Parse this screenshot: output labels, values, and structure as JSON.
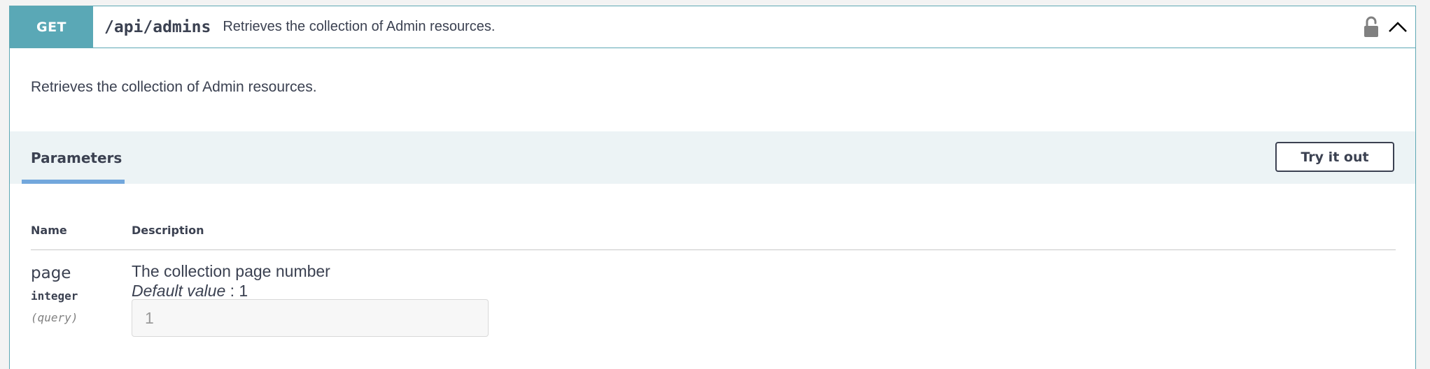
{
  "operation": {
    "method": "GET",
    "path": "/api/admins",
    "summary": "Retrieves the collection of Admin resources.",
    "description": "Retrieves the collection of Admin resources.",
    "method_color": "#5aa8b6",
    "icons": [
      "lock-icon",
      "chevron-up-icon"
    ]
  },
  "parameters_section": {
    "tab_label": "Parameters",
    "try_button_label": "Try it out",
    "columns": {
      "name": "Name",
      "description": "Description"
    }
  },
  "parameters": [
    {
      "name": "page",
      "type": "integer",
      "in": "(query)",
      "description": "The collection page number",
      "default_label": "Default value",
      "default_sep": " : ",
      "default_value": "1",
      "placeholder": "1",
      "value": ""
    }
  ]
}
